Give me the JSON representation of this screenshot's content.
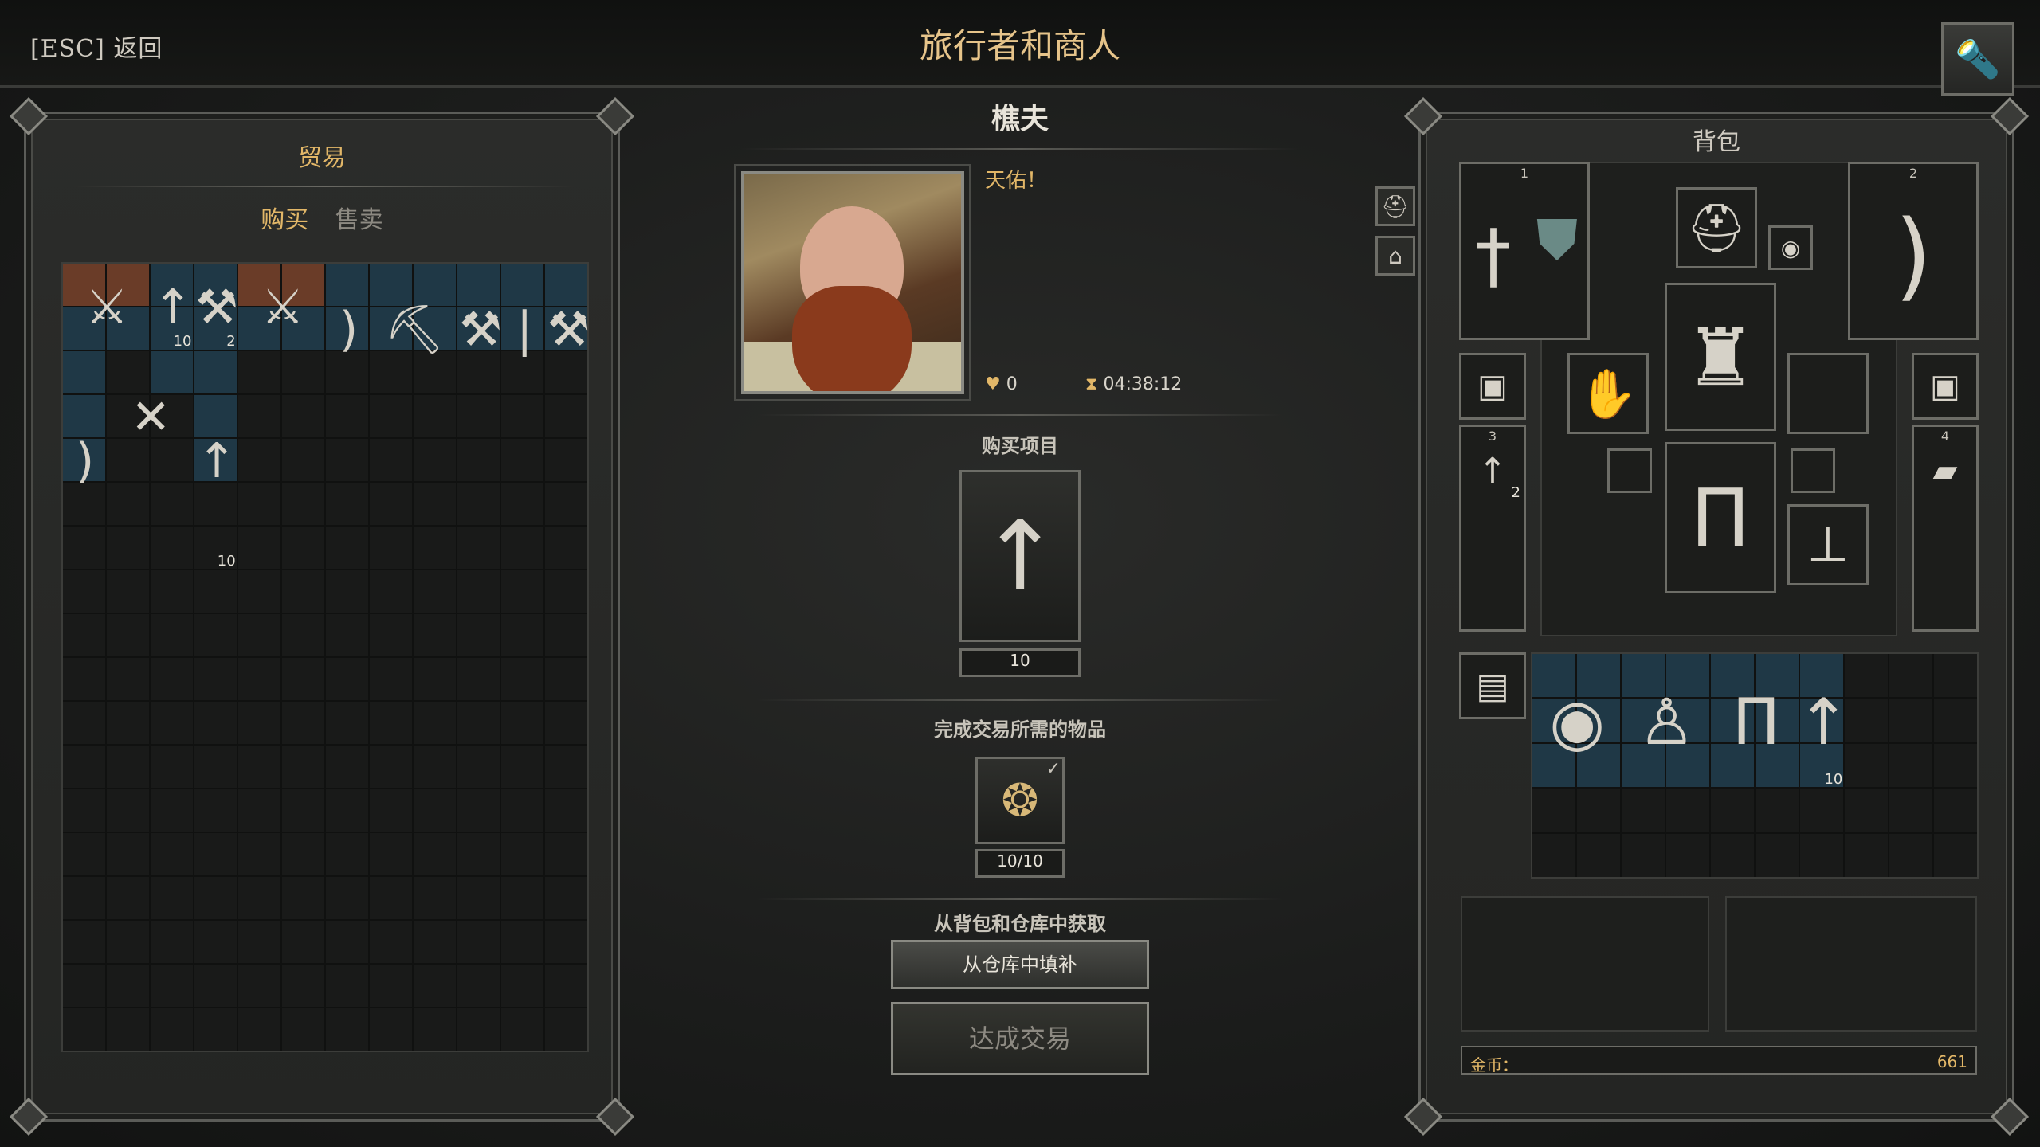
{
  "header": {
    "back_label": "[ESC] 返回",
    "title": "旅行者和商人"
  },
  "trade": {
    "title": "贸易",
    "tab_buy": "购买",
    "tab_sell": "售卖",
    "items": [
      {
        "name": "crossbow",
        "icon": "⚔",
        "qty": ""
      },
      {
        "name": "arrow-bundle",
        "icon": "↑",
        "qty": "10"
      },
      {
        "name": "axe",
        "icon": "⚒",
        "qty": "2"
      },
      {
        "name": "crossbow-2",
        "icon": "⚔",
        "qty": ""
      },
      {
        "name": "bow",
        "icon": ")",
        "qty": ""
      },
      {
        "name": "pickaxe",
        "icon": "⛏",
        "qty": ""
      },
      {
        "name": "hatchet",
        "icon": "⚒",
        "qty": ""
      },
      {
        "name": "club",
        "icon": "|",
        "qty": ""
      },
      {
        "name": "axe-2",
        "icon": "⚒",
        "qty": ""
      },
      {
        "name": "longbow",
        "icon": ")",
        "qty": ""
      },
      {
        "name": "sticks",
        "icon": "✕",
        "qty": ""
      },
      {
        "name": "arrows",
        "icon": "↑",
        "qty": "10"
      }
    ]
  },
  "npc": {
    "name": "樵夫",
    "greeting": "天佑！",
    "reputation": "0",
    "timer": "04:38:12"
  },
  "purchase": {
    "label": "购买项目",
    "item_icon": "↑",
    "count": "10"
  },
  "requirement": {
    "label": "完成交易所需的物品",
    "item_icon": "❂",
    "count": "10/10"
  },
  "fill": {
    "label": "从背包和仓库中获取",
    "fill_button": "从仓库中填补",
    "confirm_button": "达成交易"
  },
  "bag": {
    "title": "背包",
    "slot1": "1",
    "slot2": "2",
    "slot3": "3",
    "slot4": "4",
    "belt_qty": "2",
    "inv_items": [
      {
        "name": "round-shield",
        "icon": "◉",
        "qty": ""
      },
      {
        "name": "tunic",
        "icon": "♙",
        "qty": ""
      },
      {
        "name": "trousers",
        "icon": "Π",
        "qty": ""
      },
      {
        "name": "arrows",
        "icon": "↑",
        "qty": "10"
      }
    ],
    "gold_label": "金币：",
    "gold_value": "661"
  },
  "colors": {
    "accent": "#e2b768",
    "slot_blue": "#1f3846",
    "slot_rust": "#6a3c28"
  }
}
